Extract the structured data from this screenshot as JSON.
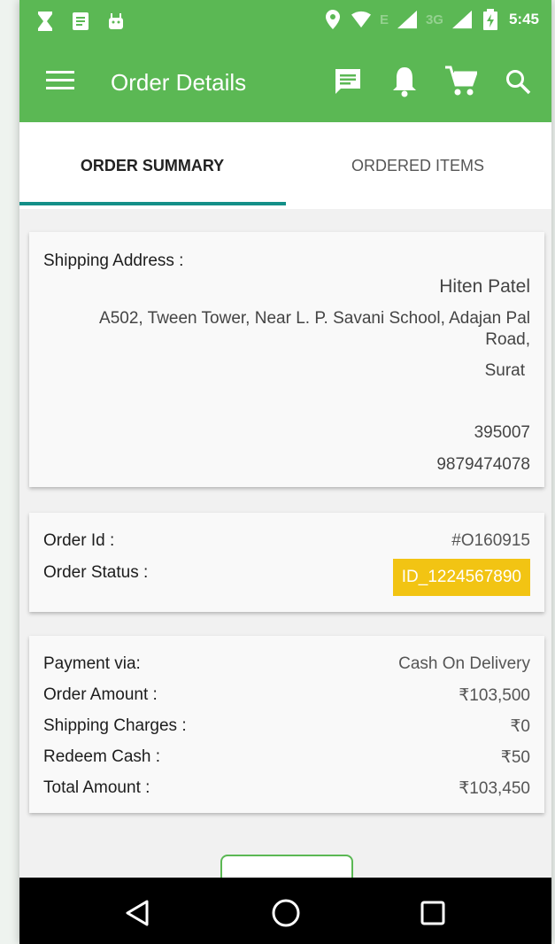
{
  "status_bar": {
    "time": "5:45",
    "network_e": "E",
    "network_3g": "3G",
    "left_icons": [
      "hourglass-icon",
      "notes-icon",
      "android-icon"
    ],
    "right_icons": [
      "location-icon",
      "wifi-icon",
      "signal-icon",
      "signal-icon",
      "battery-charging-icon"
    ]
  },
  "app_bar": {
    "title": "Order Details",
    "icons": [
      "menu-icon",
      "message-icon",
      "bell-icon",
      "cart-icon",
      "search-icon"
    ],
    "color": "#5bb854"
  },
  "tabs": [
    {
      "label": "ORDER SUMMARY",
      "active": true
    },
    {
      "label": "ORDERED ITEMS",
      "active": false
    }
  ],
  "shipping": {
    "label": "Shipping Address :",
    "name": "Hiten Patel",
    "address": "A502, Tween Tower, Near L. P. Savani School, Adajan Pal Road,",
    "city": "Surat",
    "pincode": "395007",
    "phone": "9879474078"
  },
  "order": {
    "id_label": "Order Id :",
    "id_value": "#O160915",
    "status_label": "Order Status :",
    "status_value": "ID_1224567890",
    "status_color": "#f2c413"
  },
  "payment": {
    "rows": [
      {
        "label": "Payment via:",
        "value": "Cash On Delivery"
      },
      {
        "label": "Order Amount :",
        "value": "₹103,500"
      },
      {
        "label": "Shipping Charges :",
        "value": "₹0"
      },
      {
        "label": "Redeem Cash :",
        "value": "₹50"
      },
      {
        "label": "Total Amount :",
        "value": "₹103,450"
      }
    ]
  },
  "nav_bar": {
    "icons": [
      "back-icon",
      "home-icon",
      "recents-icon"
    ]
  }
}
